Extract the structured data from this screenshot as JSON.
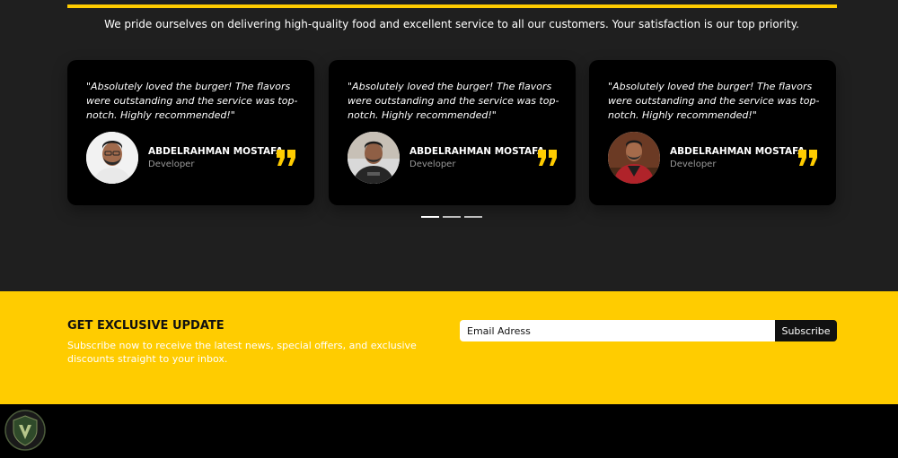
{
  "intro": {
    "text": "We pride ourselves on delivering high-quality food and excellent service to all our customers. Your satisfaction is our top priority."
  },
  "testimonials": [
    {
      "quote": "\"Absolutely loved the burger! The flavors were outstanding and the service was top-notch. Highly recommended!\"",
      "name": "ABDELRAHMAN MOSTAFA",
      "role": "Developer"
    },
    {
      "quote": "\"Absolutely loved the burger! The flavors were outstanding and the service was top-notch. Highly recommended!\"",
      "name": "ABDELRAHMAN MOSTAFA",
      "role": "Developer"
    },
    {
      "quote": "\"Absolutely loved the burger! The flavors were outstanding and the service was top-notch. Highly recommended!\"",
      "name": "ABDELRAHMAN MOSTAFA",
      "role": "Developer"
    }
  ],
  "subscribe": {
    "title": "GET EXCLUSIVE UPDATE",
    "description": "Subscribe now to receive the latest news, special offers, and exclusive discounts straight to your inbox.",
    "email_placeholder": "Email Adress",
    "button_label": "Subscribe"
  },
  "colors": {
    "accent": "#ffcc00",
    "page_background": "#1f1f1f",
    "card_background": "#000000"
  },
  "icons": {
    "quote": "quote-icon",
    "logo": "shield-logo-icon"
  }
}
